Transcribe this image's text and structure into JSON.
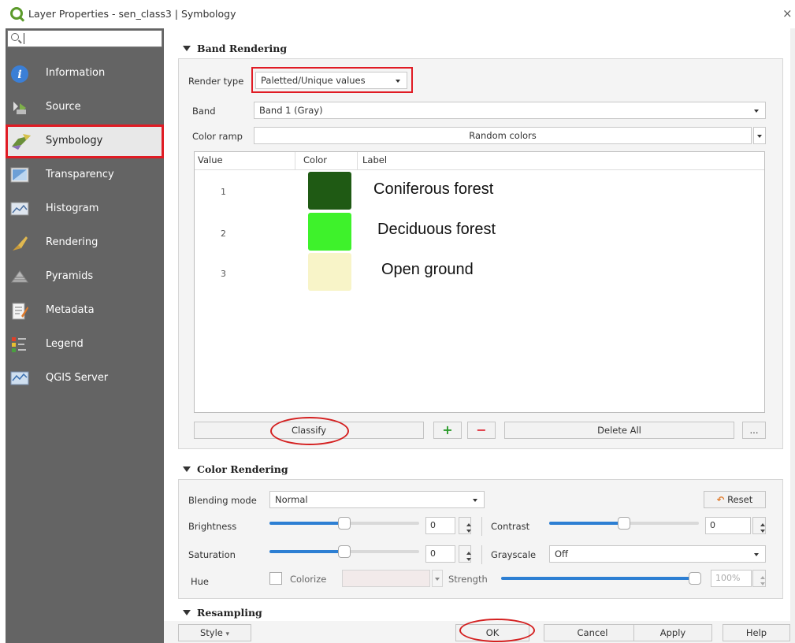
{
  "window": {
    "title": "Layer Properties - sen_class3 | Symbology",
    "close_glyph": "×"
  },
  "sidebar": {
    "search_placeholder": "",
    "items": [
      {
        "label": "Information",
        "icon": "information-icon"
      },
      {
        "label": "Source",
        "icon": "source-icon"
      },
      {
        "label": "Symbology",
        "icon": "symbology-icon",
        "active": true
      },
      {
        "label": "Transparency",
        "icon": "transparency-icon"
      },
      {
        "label": "Histogram",
        "icon": "histogram-icon"
      },
      {
        "label": "Rendering",
        "icon": "rendering-icon"
      },
      {
        "label": "Pyramids",
        "icon": "pyramids-icon"
      },
      {
        "label": "Metadata",
        "icon": "metadata-icon"
      },
      {
        "label": "Legend",
        "icon": "legend-icon"
      },
      {
        "label": "QGIS Server",
        "icon": "qgis-server-icon"
      }
    ]
  },
  "band_rendering": {
    "header": "Band Rendering",
    "render_type_label": "Render type",
    "render_type_value": "Paletted/Unique values",
    "band_label": "Band",
    "band_value": "Band 1 (Gray)",
    "color_ramp_label": "Color ramp",
    "color_ramp_value": "Random colors",
    "table": {
      "headers": [
        "Value",
        "Color",
        "Label"
      ],
      "rows": [
        {
          "value": "1",
          "color": "#1f5a14",
          "label": "Coniferous forest"
        },
        {
          "value": "2",
          "color": "#3ef22b",
          "label": "Deciduous forest"
        },
        {
          "value": "3",
          "color": "#f8f4c8",
          "label": "Open ground"
        }
      ]
    },
    "classify_label": "Classify",
    "add_glyph": "+",
    "remove_glyph": "−",
    "delete_all_label": "Delete All",
    "more_label": "..."
  },
  "color_rendering": {
    "header": "Color Rendering",
    "blending_mode_label": "Blending mode",
    "blending_mode_value": "Normal",
    "reset_label": "Reset",
    "brightness_label": "Brightness",
    "brightness_value": "0",
    "brightness_level": 0.5,
    "contrast_label": "Contrast",
    "contrast_value": "0",
    "contrast_level": 0.5,
    "saturation_label": "Saturation",
    "saturation_value": "0",
    "saturation_level": 0.5,
    "grayscale_label": "Grayscale",
    "grayscale_value": "Off",
    "hue_label": "Hue",
    "colorize_label": "Colorize",
    "strength_label": "Strength",
    "strength_value": "100%",
    "strength_level": 1.0
  },
  "resampling": {
    "header": "Resampling"
  },
  "footer": {
    "style_label": "Style",
    "ok_label": "OK",
    "cancel_label": "Cancel",
    "apply_label": "Apply",
    "help_label": "Help"
  },
  "colors": {
    "sidebar_bg": "#646464",
    "highlight_red": "#e01b24",
    "slider_blue": "#2d7fd3"
  }
}
